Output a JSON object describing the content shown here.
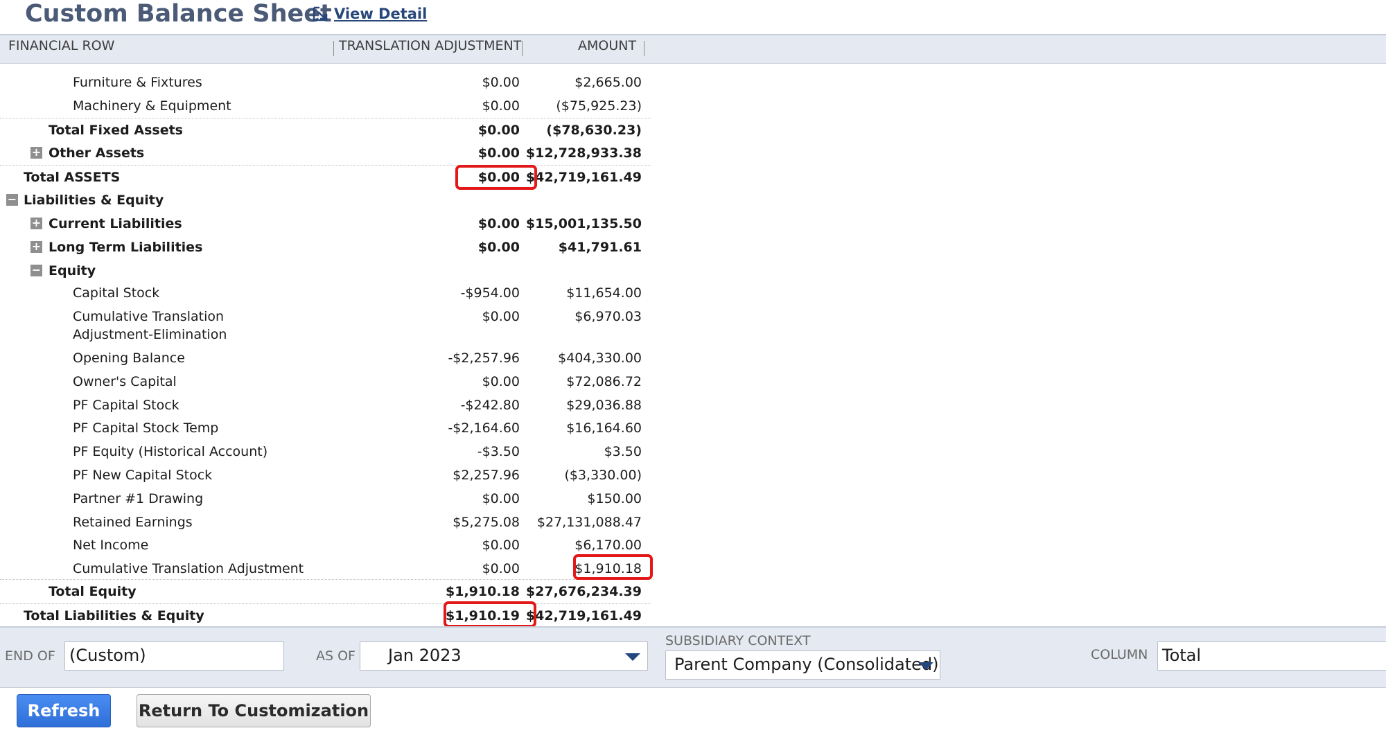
{
  "header": {
    "title": "Custom Balance Sheet",
    "view_detail": "View Detail",
    "view_detail_icon": "external-link-icon"
  },
  "columns": {
    "financial_row": "FINANCIAL ROW",
    "translation_adjustment": "TRANSLATION ADJUSTMENT",
    "amount": "AMOUNT"
  },
  "rows": [
    {
      "name": "Furniture & Fixtures",
      "translation": "$0.00",
      "amount": "$2,665.00"
    },
    {
      "name": "Machinery & Equipment",
      "translation": "$0.00",
      "amount": "($75,925.23)"
    },
    {
      "name": "Total Fixed Assets",
      "translation": "$0.00",
      "amount": "($78,630.23)"
    },
    {
      "name": "Other Assets",
      "translation": "$0.00",
      "amount": "$12,728,933.38",
      "toggle": "+"
    },
    {
      "name": "Total ASSETS",
      "translation": "$0.00",
      "amount": "$42,719,161.49"
    },
    {
      "name": "Liabilities & Equity",
      "translation": "",
      "amount": "",
      "toggle": "−"
    },
    {
      "name": "Current Liabilities",
      "translation": "$0.00",
      "amount": "$15,001,135.50",
      "toggle": "+"
    },
    {
      "name": "Long Term Liabilities",
      "translation": "$0.00",
      "amount": "$41,791.61",
      "toggle": "+"
    },
    {
      "name": "Equity",
      "translation": "",
      "amount": "",
      "toggle": "−"
    },
    {
      "name": "Capital Stock",
      "translation": "-$954.00",
      "amount": "$11,654.00"
    },
    {
      "name": "Cumulative Translation Adjustment-Elimination",
      "translation": "$0.00",
      "amount": "$6,970.03"
    },
    {
      "name": "Opening Balance",
      "translation": "-$2,257.96",
      "amount": "$404,330.00"
    },
    {
      "name": "Owner's Capital",
      "translation": "$0.00",
      "amount": "$72,086.72"
    },
    {
      "name": "PF Capital Stock",
      "translation": "-$242.80",
      "amount": "$29,036.88"
    },
    {
      "name": "PF Capital Stock Temp",
      "translation": "-$2,164.60",
      "amount": "$16,164.60"
    },
    {
      "name": "PF Equity (Historical Account)",
      "translation": "-$3.50",
      "amount": "$3.50"
    },
    {
      "name": "PF New Capital Stock",
      "translation": "$2,257.96",
      "amount": "($3,330.00)"
    },
    {
      "name": "Partner #1 Drawing",
      "translation": "$0.00",
      "amount": "$150.00"
    },
    {
      "name": "Retained Earnings",
      "translation": "$5,275.08",
      "amount": "$27,131,088.47"
    },
    {
      "name": "Net Income",
      "translation": "$0.00",
      "amount": "$6,170.00"
    },
    {
      "name": "Cumulative Translation Adjustment",
      "translation": "$0.00",
      "amount": "$1,910.18"
    },
    {
      "name": "Total Equity",
      "translation": "$1,910.18",
      "amount": "$27,676,234.39"
    },
    {
      "name": "Total Liabilities & Equity",
      "translation": "$1,910.19",
      "amount": "$42,719,161.49"
    }
  ],
  "filters": {
    "end_of_label": "END OF",
    "end_of_value": "(Custom)",
    "as_of_label": "AS OF",
    "as_of_value": "Jan 2023",
    "subsidiary_label": "SUBSIDIARY CONTEXT",
    "subsidiary_value": "Parent Company (Consolidated)",
    "column_label": "COLUMN",
    "column_value": "Total"
  },
  "buttons": {
    "refresh": "Refresh",
    "return": "Return To Customization"
  },
  "colors": {
    "title": "#4a5a77",
    "link": "#27477a",
    "highlight": "#e31818",
    "refresh_button": "#2e6fd8"
  }
}
